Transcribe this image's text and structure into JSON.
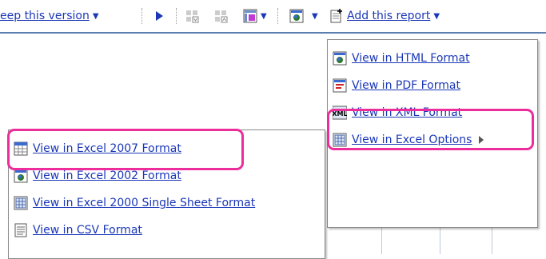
{
  "toolbar": {
    "keep_version_label": "eep this version",
    "add_report_label": "Add this report"
  },
  "report_menu": {
    "items": [
      {
        "label": "View in HTML Format",
        "icon": "html-format-icon"
      },
      {
        "label": "View in PDF Format",
        "icon": "pdf-format-icon"
      },
      {
        "label": "View in XML Format",
        "icon": "xml-format-icon"
      },
      {
        "label": "View in Excel Options",
        "icon": "excel-options-icon"
      }
    ]
  },
  "excel_submenu": {
    "items": [
      {
        "label": "View in Excel 2007 Format",
        "icon": "excel-2007-icon"
      },
      {
        "label": "View in Excel 2002 Format",
        "icon": "excel-2002-icon"
      },
      {
        "label": "View in Excel 2000 Single Sheet Format",
        "icon": "excel-2000-icon"
      },
      {
        "label": "View in CSV Format",
        "icon": "csv-format-icon"
      }
    ]
  },
  "colors": {
    "link": "#1a37b7",
    "highlight": "#ee2d9c",
    "toolbar_border": "#5a7fb0"
  }
}
